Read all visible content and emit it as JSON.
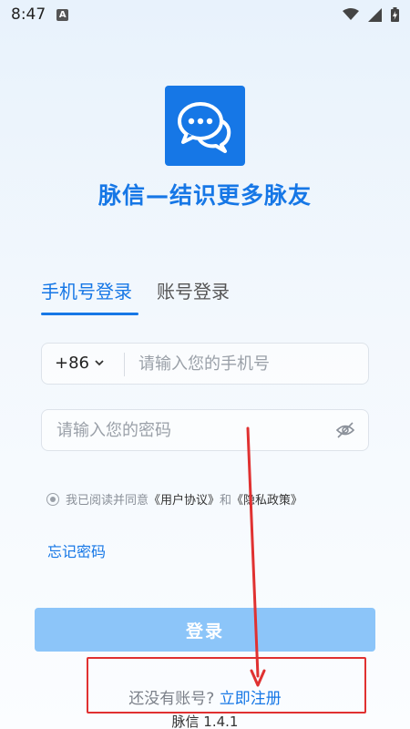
{
  "status_bar": {
    "time": "8:47",
    "a_icon_letter": "A"
  },
  "app": {
    "title": "脉信—结识更多脉友"
  },
  "tabs": [
    {
      "label": "手机号登录",
      "active": true
    },
    {
      "label": "账号登录",
      "active": false
    }
  ],
  "phone": {
    "country_code": "+86",
    "placeholder": "请输入您的手机号"
  },
  "password": {
    "placeholder": "请输入您的密码"
  },
  "agreement": {
    "prefix": "我已阅读并同意",
    "user_agreement": "《用户协议》",
    "and": "和",
    "privacy_policy": "《隐私政策》"
  },
  "forgot_password": "忘记密码",
  "login_button": "登录",
  "register": {
    "question": "还没有账号?",
    "link": "立即注册"
  },
  "version": "脉信 1.4.1",
  "colors": {
    "brand": "#1677e6",
    "login_button_disabled": "#8cc5f9",
    "annotation": "#e03131"
  }
}
